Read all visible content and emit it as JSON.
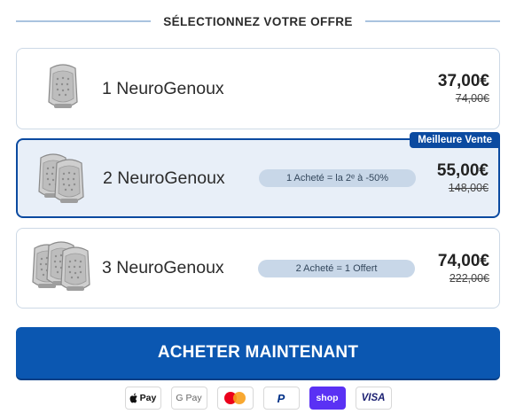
{
  "header": {
    "title": "SÉLECTIONNEZ VOTRE OFFRE"
  },
  "offers": [
    {
      "name": "1 NeuroGenoux",
      "price": "37,00€",
      "old_price": "74,00€",
      "promo": "",
      "selected": false
    },
    {
      "name": "2 NeuroGenoux",
      "price": "55,00€",
      "old_price": "148,00€",
      "promo": "1 Acheté = la 2ᵉ à -50%",
      "selected": true,
      "badge": "Meilleure Vente"
    },
    {
      "name": "3 NeuroGenoux",
      "price": "74,00€",
      "old_price": "222,00€",
      "promo": "2 Acheté = 1 Offert",
      "selected": false
    }
  ],
  "cta": {
    "label": "ACHETER MAINTENANT"
  },
  "payments": {
    "apple": "Pay",
    "google": "G Pay",
    "paypal": "P",
    "shop": "shop",
    "visa": "VISA"
  },
  "colors": {
    "accent": "#0b57b1",
    "selected_border": "#0b4aa0",
    "selected_bg": "#e8eff8",
    "pill": "#c8d7e8"
  }
}
